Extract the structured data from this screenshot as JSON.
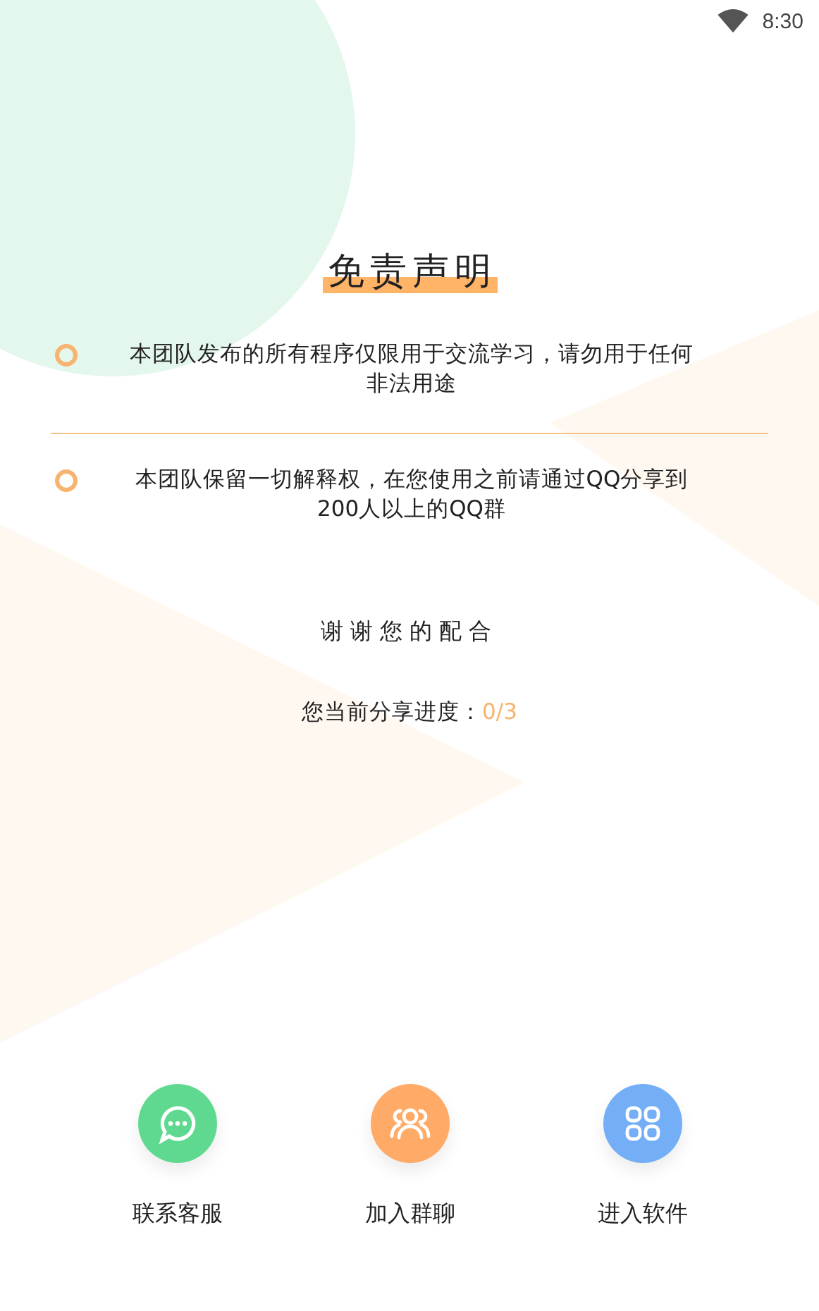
{
  "status_bar": {
    "time": "8:30"
  },
  "title": "免责声明",
  "notices": [
    {
      "lines": [
        "本团队发布的所有程序仅限用于交流学习，请勿用于任何",
        "非法用途"
      ]
    },
    {
      "lines": [
        "本团队保留一切解释权，在您使用之前请通过QQ分享到",
        "200人以上的QQ群"
      ]
    }
  ],
  "thanks": "谢谢您的配合",
  "progress": {
    "label": "您当前分享进度：",
    "value": "0/3"
  },
  "actions": [
    {
      "kind": "chat",
      "label": "联系客服",
      "color": "#5fd98f"
    },
    {
      "kind": "group",
      "label": "加入群聊",
      "color": "#ffaa66"
    },
    {
      "kind": "apps",
      "label": "进入软件",
      "color": "#73aef7"
    }
  ]
}
